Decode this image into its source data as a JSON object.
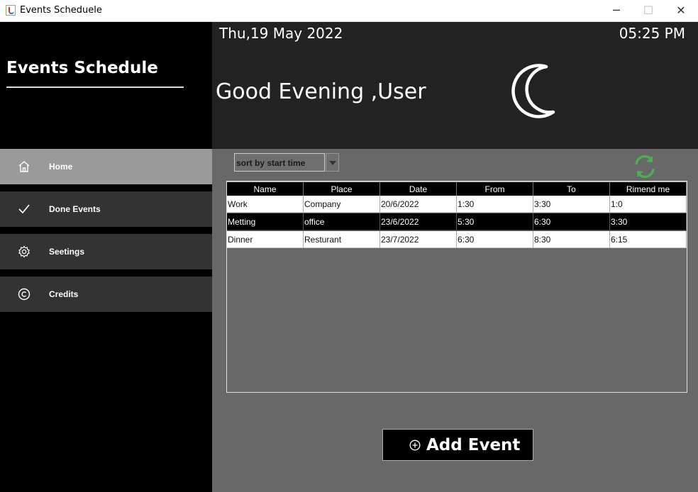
{
  "window": {
    "title": "Events Scheduele",
    "minimize": "─",
    "maximize": "☐",
    "close": "✕"
  },
  "sidebar": {
    "brand": "Events Schedule",
    "items": [
      {
        "label": "Home",
        "icon": "home-icon",
        "active": true
      },
      {
        "label": "Done Events",
        "icon": "check-icon",
        "active": false
      },
      {
        "label": "Seetings",
        "icon": "gear-icon",
        "active": false
      },
      {
        "label": "Credits",
        "icon": "copyright-icon",
        "active": false
      }
    ]
  },
  "header": {
    "date": "Thu,19 May 2022",
    "time": "05:25 PM",
    "greeting": "Good Evening ,User",
    "icon": "moon-icon"
  },
  "toolbar": {
    "sort_value": "sort by start time",
    "refresh_icon": "refresh-icon",
    "refresh_color": "#4caf50"
  },
  "table": {
    "columns": [
      "Name",
      "Place",
      "Date",
      "From",
      "To",
      "Rimend me"
    ],
    "rows": [
      [
        "Work",
        "Company",
        "20/6/2022",
        "1:30",
        "3:30",
        "1:0"
      ],
      [
        "Metting",
        "office",
        "23/6/2022",
        "5:30",
        "6:30",
        "3:30"
      ],
      [
        "Dinner",
        "Resturant",
        "23/7/2022",
        "6:30",
        "8:30",
        "6:15"
      ]
    ],
    "selected_row": 1
  },
  "actions": {
    "add_label": "Add Event",
    "add_icon": "plus-circle-icon"
  }
}
